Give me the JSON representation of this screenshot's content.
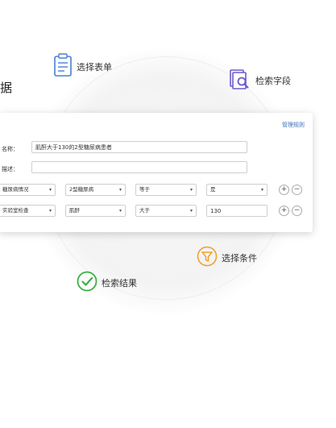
{
  "heading_fragment": "据",
  "features": {
    "select_form": "选择表单",
    "search_fields": "检索字段",
    "select_conditions": "选择条件",
    "search_results": "检索结果"
  },
  "form": {
    "manage_rules_link": "管理规则",
    "name_label": "名称：",
    "name_value": "肌酐大于130的2型糖尿病患者",
    "desc_label": "描述：",
    "desc_value": "",
    "rows": [
      {
        "field": "糖尿病情况",
        "item": "2型糖尿病",
        "operator": "等于",
        "value": "是",
        "value_is_select": true
      },
      {
        "field": "实验室检查",
        "item": "肌酐",
        "operator": "大于",
        "value": "130",
        "value_is_select": false
      }
    ],
    "add_symbol": "+",
    "remove_symbol": "−",
    "caret_symbol": "▾"
  },
  "colors": {
    "link": "#3d6fb5",
    "form_icon": "#4a7fd4",
    "search_icon": "#6a5acd",
    "filter_icon": "#f0a030",
    "check_icon": "#3cb043"
  },
  "icons": [
    "clipboard-icon",
    "search-document-icon",
    "filter-icon",
    "checkmark-icon"
  ]
}
